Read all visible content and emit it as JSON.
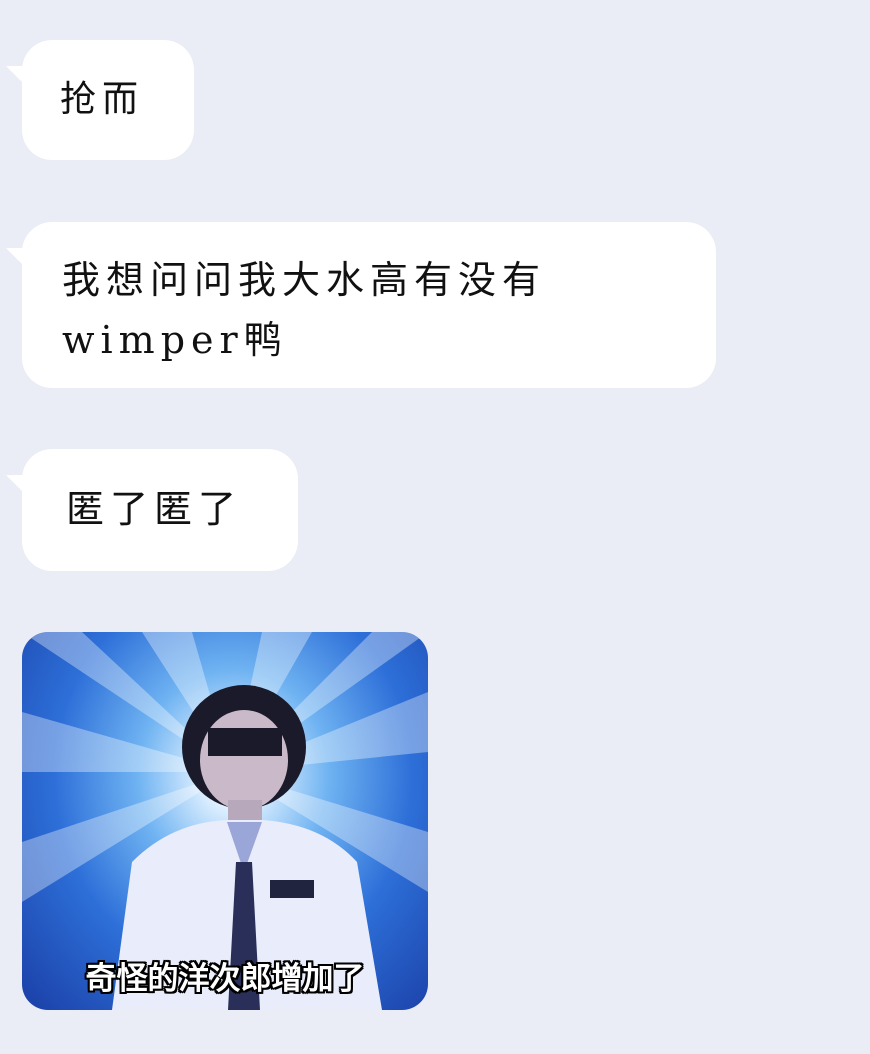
{
  "messages": [
    {
      "text": "抢而"
    },
    {
      "text": "我想问问我大水高有没有\nwimper鸭"
    },
    {
      "text": "匿了匿了"
    }
  ],
  "sticker": {
    "caption": "奇怪的洋次郎增加了"
  },
  "colors": {
    "background": "#eaecf6",
    "bubble": "#ffffff",
    "text": "#111111"
  }
}
